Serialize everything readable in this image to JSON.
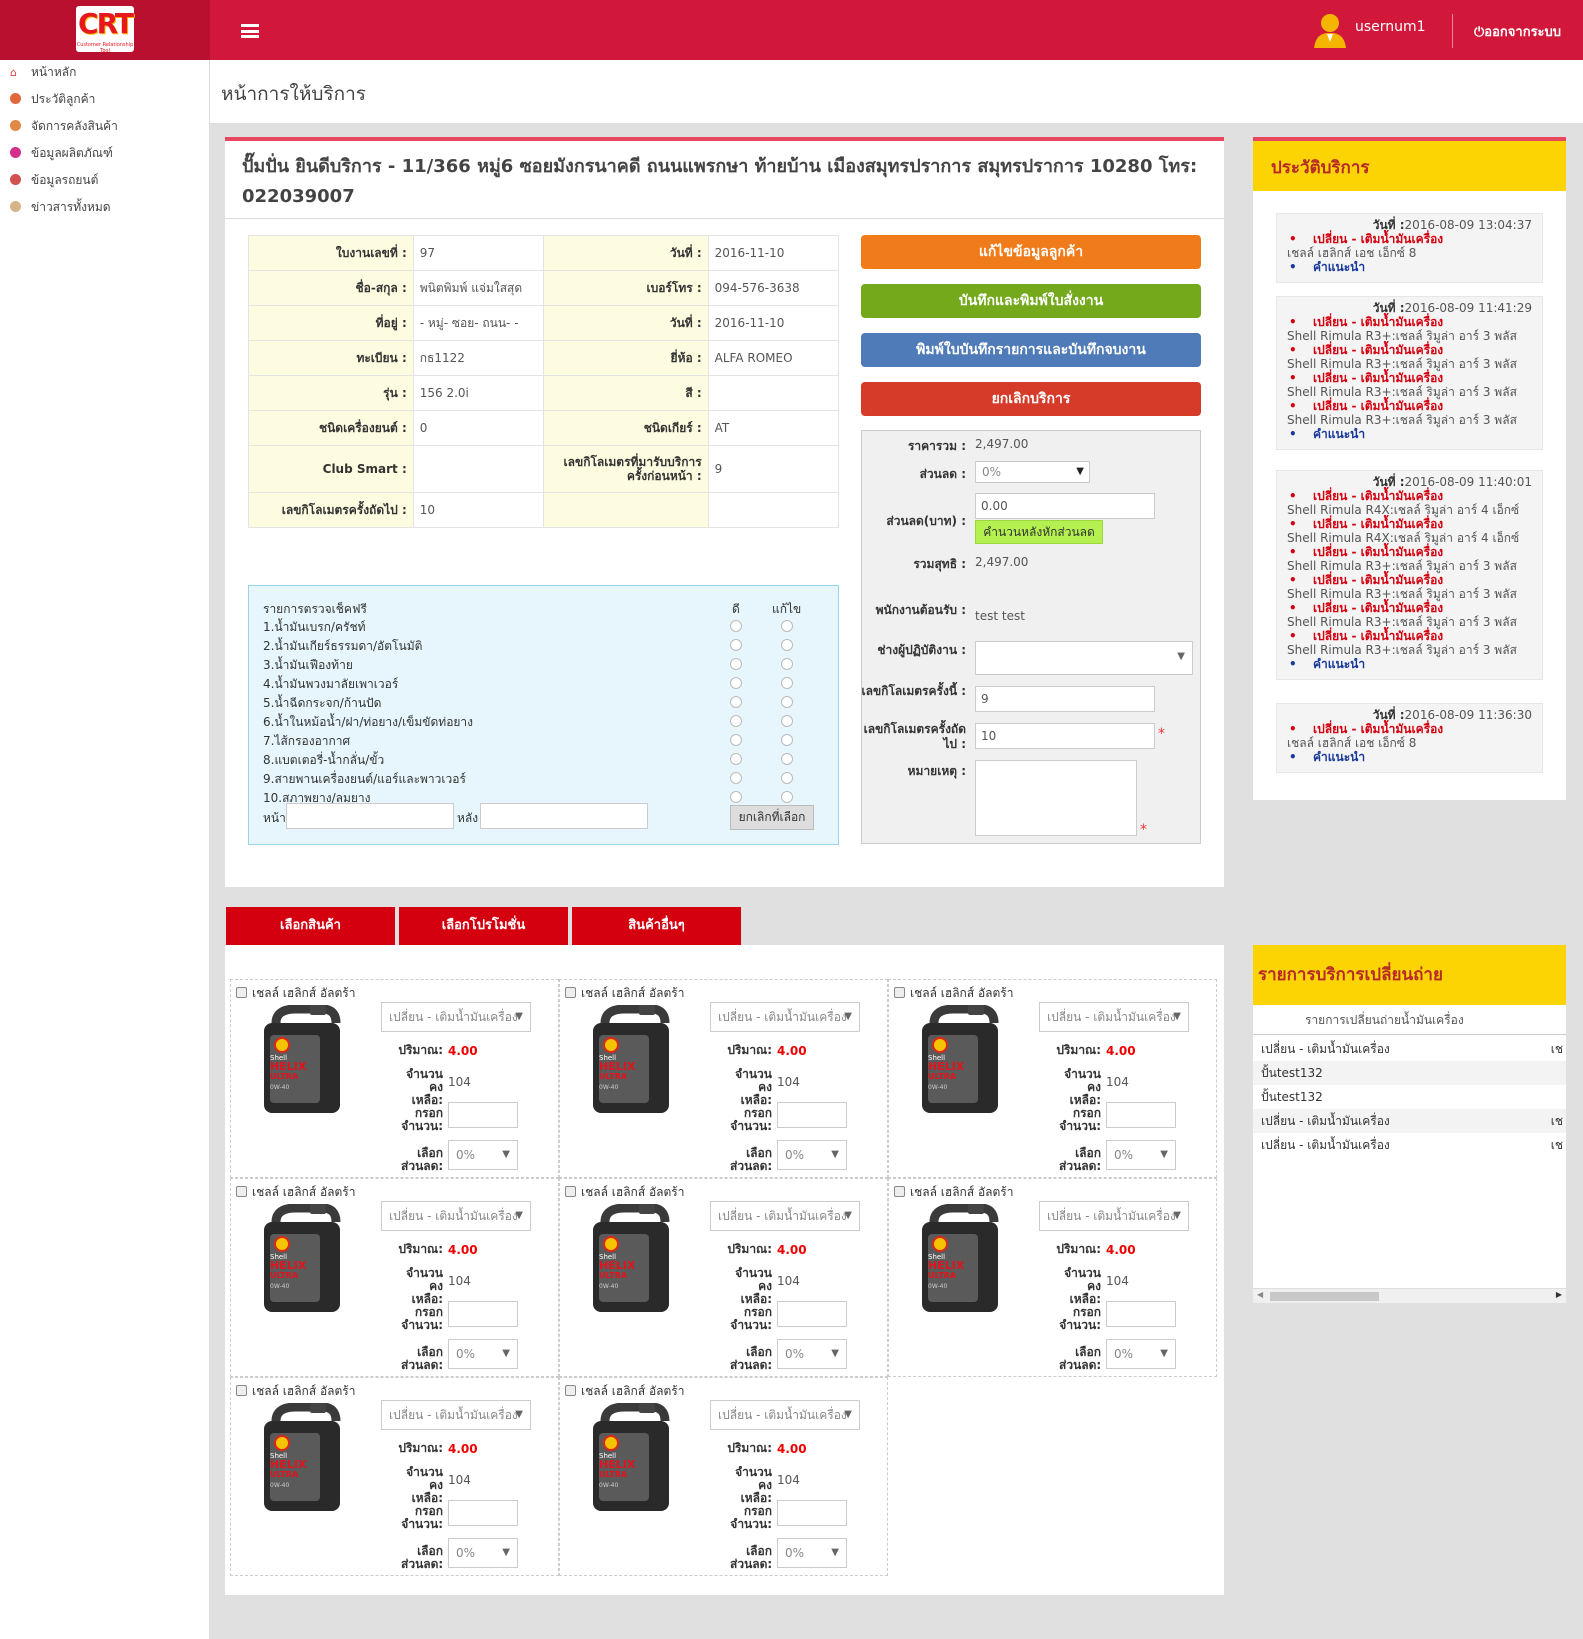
{
  "header": {
    "logo": "CRT",
    "logo_sub": "Customer Relationship Tool",
    "user": "usernum1",
    "logout": "ออกจากระบบ"
  },
  "sidebar": [
    {
      "label": "หน้าหลัก",
      "color": "#e0433e"
    },
    {
      "label": "ประวัติลูกค้า",
      "color": "#e0683a"
    },
    {
      "label": "จัดการคลังสินค้า",
      "color": "#e08846"
    },
    {
      "label": "ข้อมูลผลิตภัณฑ์",
      "color": "#d42f8a"
    },
    {
      "label": "ข้อมูลรถยนต์",
      "color": "#d25050"
    },
    {
      "label": "ข่าวสารทั้งหมด",
      "color": "#d6b48a"
    }
  ],
  "page_title": "หน้าการให้บริการ",
  "shop_title": "ปั๊มปั่น ยินดีบริการ - 11/366 หมู่6 ซอยมังกรนาคดี ถนนแพรกษา ท้ายบ้าน เมืองสมุทรปราการ สมุทรปราการ 10280 โทร: 022039007",
  "info": [
    [
      "ใบงานเลขที่ :",
      "97",
      "วันที่ :",
      "2016-11-10"
    ],
    [
      "ชื่อ-สกุล :",
      "พนิตพิมพ์ แจ่มใสสุด",
      "เบอร์โทร :",
      "094-576-3638"
    ],
    [
      "ที่อยู่ :",
      "- หมู่- ซอย- ถนน- -",
      "วันที่ :",
      "2016-11-10"
    ],
    [
      "ทะเบียน :",
      "กธ1122",
      "ยี่ห้อ :",
      "ALFA ROMEO"
    ],
    [
      "รุ่น :",
      "156 2.0i",
      "สี :",
      ""
    ],
    [
      "ชนิดเครื่องยนต์ :",
      "0",
      "ชนิดเกียร์ :",
      "AT"
    ],
    [
      "Club Smart :",
      "",
      "เลขกิโลเมตรที่มารับบริการครั้งก่อนหน้า :",
      "9"
    ],
    [
      "เลขกิโลเมตรครั้งถัดไป :",
      "10",
      "",
      ""
    ]
  ],
  "buttons": {
    "edit": "แก้ไขข้อมูลลูกค้า",
    "save_print": "บันทึกและพิมพ์ใบสั่งงาน",
    "print_close": "พิมพ์ใบบันทึกรายการและบันทึกจบงาน",
    "cancel": "ยกเลิกบริการ"
  },
  "price": {
    "total_label": "ราคารวม :",
    "total": "2,497.00",
    "discount_label": "ส่วนลด :",
    "discount": "0%",
    "discount_baht_label": "ส่วนลด(บาท) :",
    "discount_baht": "0.00",
    "calc_btn": "คำนวนหลังหักส่วนลด",
    "net_label": "รวมสุทธิ :",
    "net": "2,497.00",
    "receiver_label": "พนักงานต้อนรับ :",
    "receiver": "test test",
    "mechanic_label": "ช่างผู้ปฏิบัติงาน :",
    "km_now_label": "เลขกิโลเมตรครั้งนี้ :",
    "km_now": "9",
    "km_next_label": "เลขกิโลเมตรครั้งถัดไป :",
    "km_next": "10",
    "note_label": "หมายเหตุ :"
  },
  "checklist": {
    "header": "รายการตรวจเช็คฟรี",
    "good": "ดี",
    "fix": "แก้ไข",
    "items": [
      "1.น้ำมันเบรก/ครัชท์",
      "2.น้ำมันเกียร์ธรรมดา/อัตโนมัติ",
      "3.น้ำมันเฟืองท้าย",
      "4.น้ำมันพวงมาลัยเพาเวอร์",
      "5.น้ำฉีดกระจก/ก้านปัด",
      "6.น้ำในหม้อน้ำ/ฝา/ท่อยาง/เข็มขัดท่อยาง",
      "7.ไส้กรองอากาศ",
      "8.แบตเตอรี่-น้ำกลั่น/ขั้ว",
      "9.สายพานเครื่องยนต์/แอร์และพาวเวอร์",
      "10.สภาพยาง/ลมยาง"
    ],
    "front": "หน้า",
    "back": "หลัง",
    "cancel_btn": "ยกเลิกที่เลือก"
  },
  "tabs": [
    "เลือกสินค้า",
    "เลือกโปรโมชั่น",
    "สินค้าอื่นๆ"
  ],
  "products": {
    "name": "เชลล์ เฮลิกส์ อัลตร้า",
    "select": "เปลี่ยน - เติมน้ำมันเครื่อง",
    "qty_label": "ปริมาณ:",
    "qty": "4.00",
    "stock_label": "จำนวนคงเหลือ:",
    "stock": "104",
    "fill_label": "กรอกจำนวน:",
    "disc_label": "เลือกส่วนลด:",
    "disc": "0%",
    "count": 8,
    "bottle": {
      "brand": "Shell",
      "line1": "HELIX",
      "line2": "ULTRA",
      "grade": "0W-40"
    }
  },
  "history": {
    "title": "ประวัติบริการ",
    "date_label": "วันที่ :",
    "entries": [
      {
        "date": "2016-08-09 13:04:37",
        "lines": [
          {
            "t": "change",
            "v": "เปลี่ยน - เติมน้ำมันเครื่อง"
          },
          {
            "t": "prod",
            "v": "เชลล์ เฮลิกส์ เอช เอ็กซ์ 8"
          },
          {
            "t": "note",
            "v": "คำแนะนำ"
          }
        ]
      },
      {
        "date": "2016-08-09 11:41:29",
        "lines": [
          {
            "t": "change",
            "v": "เปลี่ยน - เติมน้ำมันเครื่อง"
          },
          {
            "t": "prod",
            "v": "Shell Rimula R3+:เชลล์ ริมูล่า อาร์ 3 พลัส"
          },
          {
            "t": "change",
            "v": "เปลี่ยน - เติมน้ำมันเครื่อง"
          },
          {
            "t": "prod",
            "v": "Shell Rimula R3+:เชลล์ ริมูล่า อาร์ 3 พลัส"
          },
          {
            "t": "change",
            "v": "เปลี่ยน - เติมน้ำมันเครื่อง"
          },
          {
            "t": "prod",
            "v": "Shell Rimula R3+:เชลล์ ริมูล่า อาร์ 3 พลัส"
          },
          {
            "t": "change",
            "v": "เปลี่ยน - เติมน้ำมันเครื่อง"
          },
          {
            "t": "prod",
            "v": "Shell Rimula R3+:เชลล์ ริมูล่า อาร์ 3 พลัส"
          },
          {
            "t": "note",
            "v": "คำแนะนำ"
          }
        ]
      },
      {
        "date": "2016-08-09 11:40:01",
        "lines": [
          {
            "t": "change",
            "v": "เปลี่ยน - เติมน้ำมันเครื่อง"
          },
          {
            "t": "prod",
            "v": "Shell Rimula R4X:เชลล์ ริมูล่า อาร์ 4 เอ็กซ์"
          },
          {
            "t": "change",
            "v": "เปลี่ยน - เติมน้ำมันเครื่อง"
          },
          {
            "t": "prod",
            "v": "Shell Rimula R4X:เชลล์ ริมูล่า อาร์ 4 เอ็กซ์"
          },
          {
            "t": "change",
            "v": "เปลี่ยน - เติมน้ำมันเครื่อง"
          },
          {
            "t": "prod",
            "v": "Shell Rimula R3+:เชลล์ ริมูล่า อาร์ 3 พลัส"
          },
          {
            "t": "change",
            "v": "เปลี่ยน - เติมน้ำมันเครื่อง"
          },
          {
            "t": "prod",
            "v": "Shell Rimula R3+:เชลล์ ริมูล่า อาร์ 3 พลัส"
          },
          {
            "t": "change",
            "v": "เปลี่ยน - เติมน้ำมันเครื่อง"
          },
          {
            "t": "prod",
            "v": "Shell Rimula R3+:เชลล์ ริมูล่า อาร์ 3 พลัส"
          },
          {
            "t": "change",
            "v": "เปลี่ยน - เติมน้ำมันเครื่อง"
          },
          {
            "t": "prod",
            "v": "Shell Rimula R3+:เชลล์ ริมูล่า อาร์ 3 พลัส"
          },
          {
            "t": "note",
            "v": "คำแนะนำ"
          }
        ]
      },
      {
        "date": "2016-08-09 11:36:30",
        "lines": [
          {
            "t": "change",
            "v": "เปลี่ยน - เติมน้ำมันเครื่อง"
          },
          {
            "t": "prod",
            "v": "เชลล์ เฮลิกส์ เอช เอ็กซ์ 8"
          },
          {
            "t": "note",
            "v": "คำแนะนำ"
          }
        ]
      }
    ]
  },
  "change_list": {
    "title": "รายการบริการเปลี่ยนถ่าย",
    "col": "รายการเปลี่ยนถ่ายน้ำมันเครื่อง",
    "rows": [
      {
        "a": "เปลี่ยน - เติมน้ำมันเครื่อง",
        "b": "เช"
      },
      {
        "a": "ปั้นtest132",
        "b": ""
      },
      {
        "a": "ปั้นtest132",
        "b": ""
      },
      {
        "a": "เปลี่ยน - เติมน้ำมันเครื่อง",
        "b": "เช"
      },
      {
        "a": "เปลี่ยน - เติมน้ำมันเครื่อง",
        "b": "เช"
      }
    ]
  }
}
